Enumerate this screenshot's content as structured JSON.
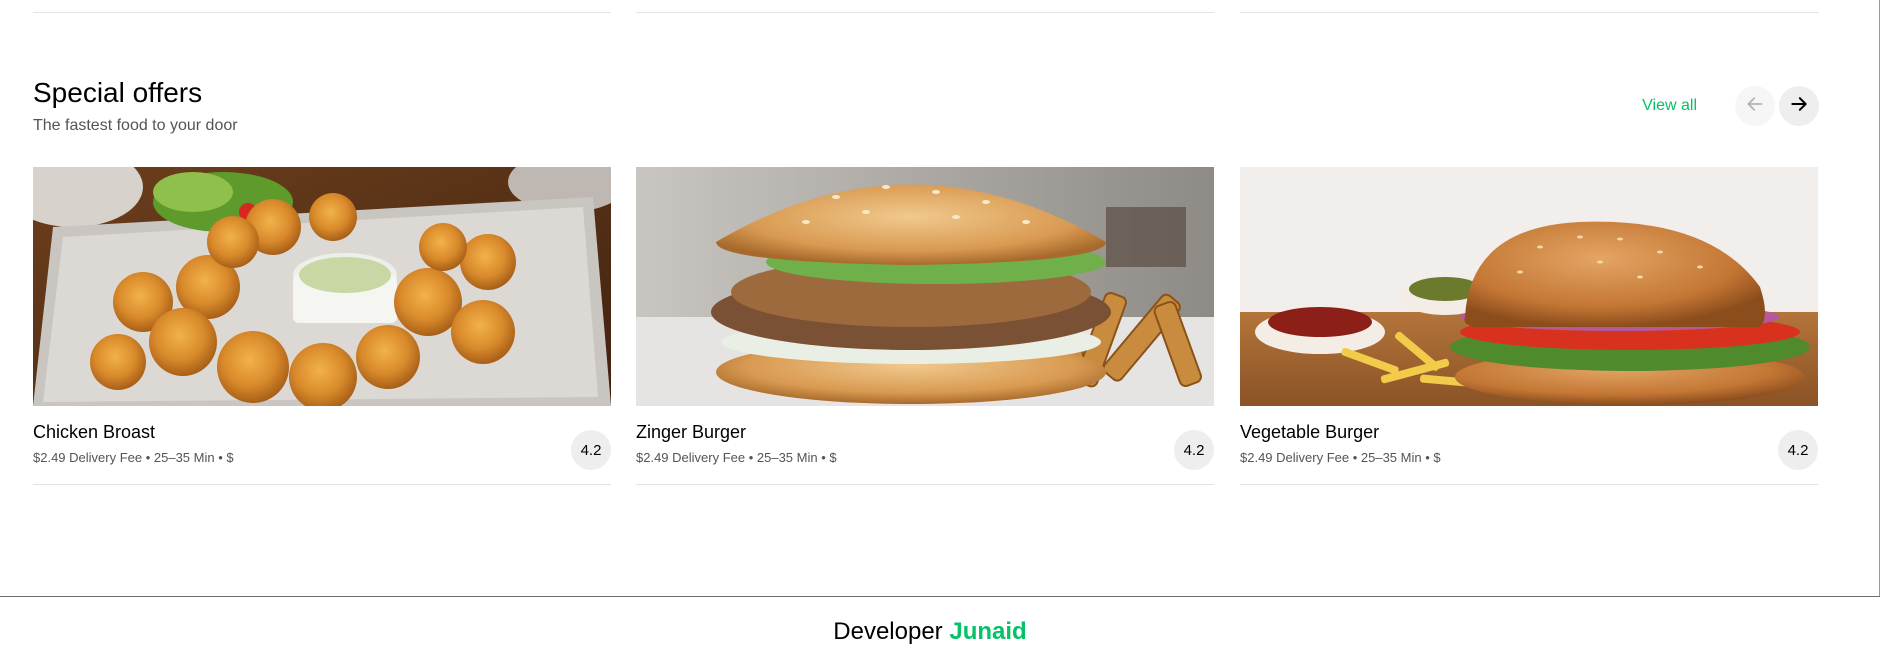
{
  "section": {
    "title": "Special offers",
    "subtitle": "The fastest food to your door",
    "view_all_label": "View all",
    "prev_icon": "arrow-left-icon",
    "next_icon": "arrow-right-icon"
  },
  "cards": [
    {
      "title": "Chicken Broast",
      "meta": "$2.49 Delivery Fee • 25–35 Min • $",
      "rating": "4.2",
      "image": "chicken-broast-photo"
    },
    {
      "title": "Zinger Burger",
      "meta": "$2.49 Delivery Fee • 25–35 Min • $",
      "rating": "4.2",
      "image": "zinger-burger-photo"
    },
    {
      "title": "Vegetable Burger",
      "meta": "$2.49 Delivery Fee • 25–35 Min • $",
      "rating": "4.2",
      "image": "vegetable-burger-photo"
    }
  ],
  "footer": {
    "prefix": "Developer",
    "name": "Junaid"
  },
  "colors": {
    "accent": "#06c167",
    "text": "#000000",
    "muted": "#545454",
    "rating_bg": "#eeeeee"
  }
}
